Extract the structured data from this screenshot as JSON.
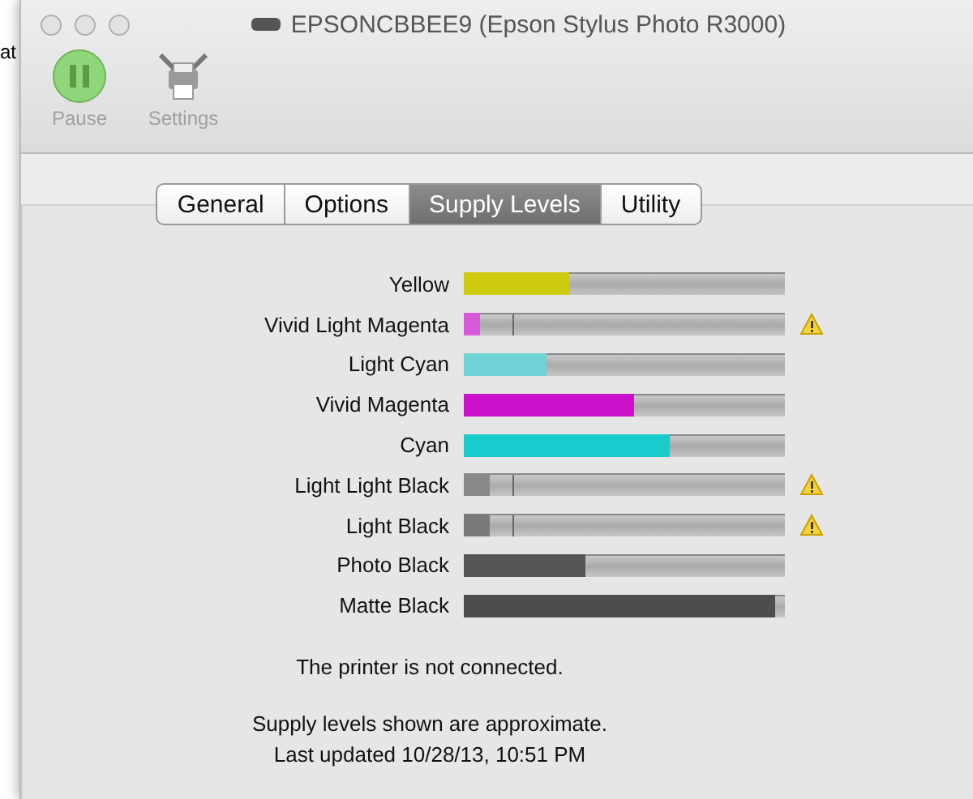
{
  "background_text": "at",
  "window": {
    "title": "EPSONCBBEE9 (Epson Stylus Photo R3000)"
  },
  "toolbar": [
    {
      "kind": "pause",
      "label": "Pause"
    },
    {
      "kind": "settings",
      "label": "Settings"
    }
  ],
  "tabs": [
    {
      "label": "General",
      "selected": false
    },
    {
      "label": "Options",
      "selected": false
    },
    {
      "label": "Supply Levels",
      "selected": true
    },
    {
      "label": "Utility",
      "selected": false
    }
  ],
  "supplies": [
    {
      "name": "Yellow",
      "color": "#cfcc10",
      "level": 0.33,
      "warning": false
    },
    {
      "name": "Vivid Light Magenta",
      "color": "#d95ad8",
      "level": 0.05,
      "warning": true
    },
    {
      "name": "Light Cyan",
      "color": "#6fd3d6",
      "level": 0.26,
      "warning": false
    },
    {
      "name": "Vivid Magenta",
      "color": "#cc10cc",
      "level": 0.53,
      "warning": false
    },
    {
      "name": "Cyan",
      "color": "#18cccc",
      "level": 0.64,
      "warning": false
    },
    {
      "name": "Light Light Black",
      "color": "#888888",
      "level": 0.08,
      "warning": true
    },
    {
      "name": "Light Black",
      "color": "#7a7a7a",
      "level": 0.08,
      "warning": true
    },
    {
      "name": "Photo Black",
      "color": "#555555",
      "level": 0.38,
      "warning": false
    },
    {
      "name": "Matte Black",
      "color": "#4d4d4d",
      "level": 0.97,
      "warning": false
    }
  ],
  "status": "The printer is not connected.",
  "notes": [
    "Supply levels shown are approximate.",
    "Last updated 10/28/13, 10:51 PM"
  ]
}
